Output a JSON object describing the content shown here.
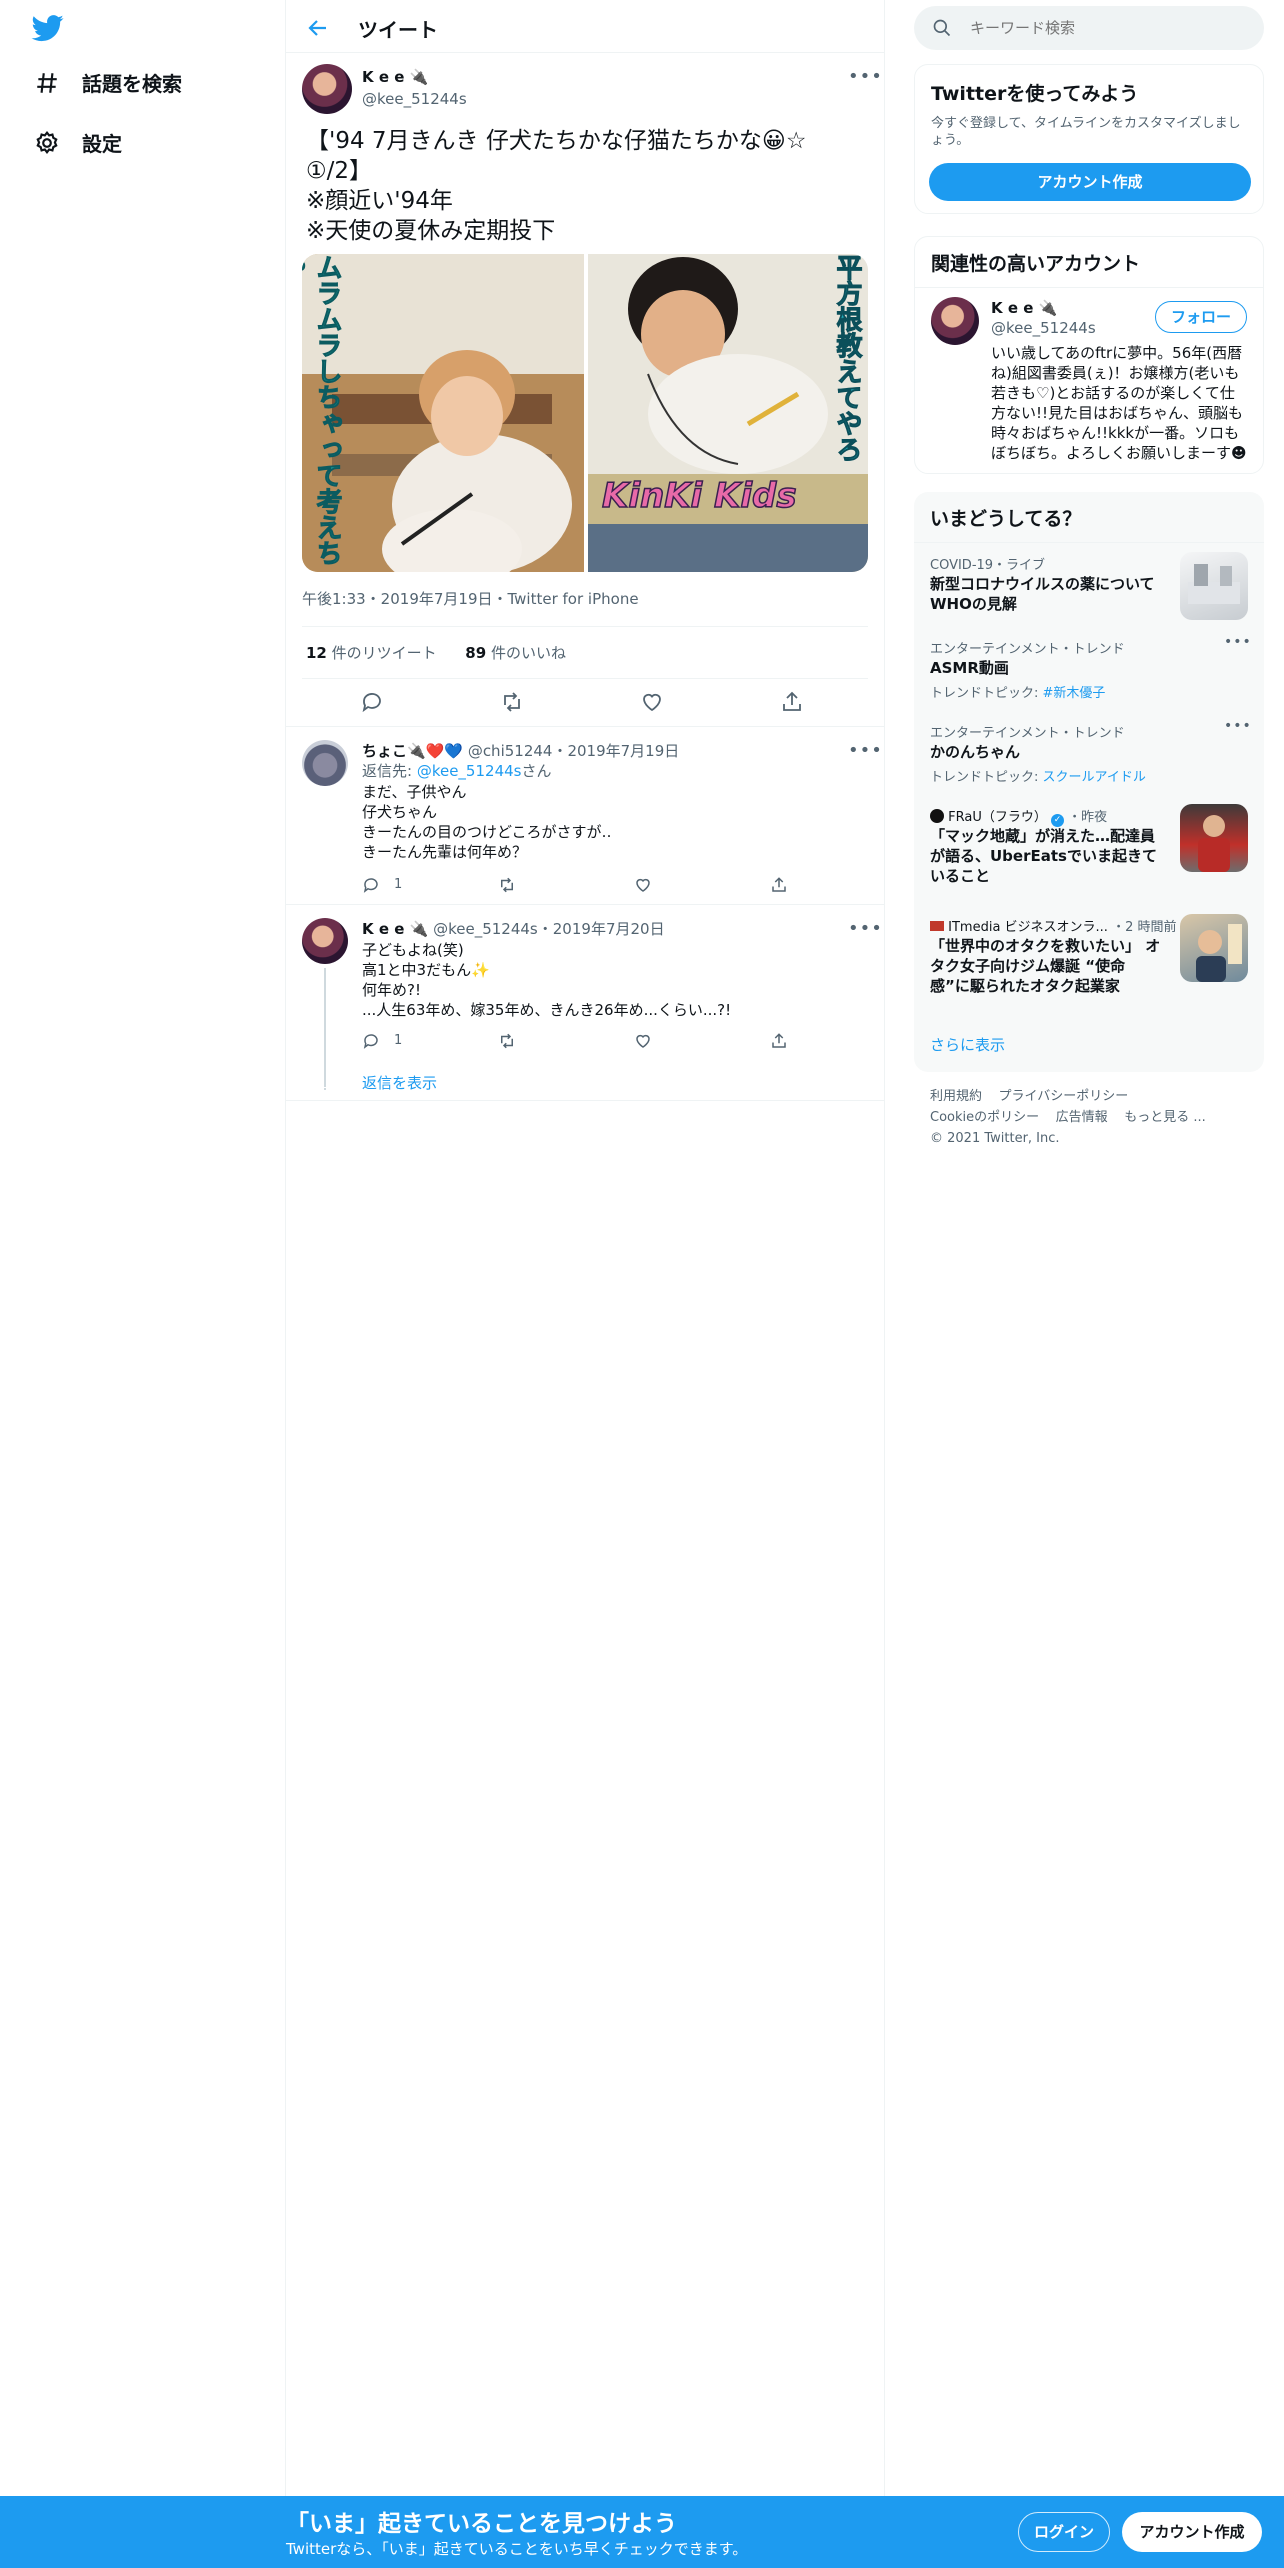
{
  "nav": {
    "search_label": "話題を検索",
    "settings_label": "設定"
  },
  "header": {
    "title": "ツイート"
  },
  "tweet": {
    "name": "K e e 🔌",
    "handle": "@kee_51244s",
    "lines": [
      "【'94 7月きんき 仔犬たちかな仔猫たちかな😀☆",
      "①/2】",
      "※顔近い'94年",
      "※天使の夏休み定期投下"
    ],
    "photo_left_text": "ムラムラしちゃって考えちゃう",
    "photo_right_text": "平方根教えてやろ",
    "photo_right_logo": "KinKi Kids",
    "meta": "午後1:33・2019年7月19日・Twitter for iPhone",
    "retweets": "12",
    "retweets_label": "件のリツイート",
    "likes": "89",
    "likes_label": "件のいいね"
  },
  "replies": [
    {
      "name": "ちょこ🔌❤️💙",
      "handle": "@chi51244",
      "date": "・2019年7月19日",
      "reply_to_label": "返信先: ",
      "reply_to": "@kee_51244s",
      "reply_to_suffix": "さん",
      "lines": [
        "まだ、子供やん",
        "仔犬ちゃん",
        "きーたんの目のつけどころがさすが‥",
        "きーたん先輩は何年め？"
      ],
      "reply_count": "1"
    },
    {
      "name": "K e e 🔌",
      "handle": "@kee_51244s",
      "date": "・2019年7月20日",
      "lines": [
        "子どもよね(笑)",
        "高1と中3だもん✨",
        "何年め?!",
        "...人生63年め、嫁35年め、きんき26年め...くらい...?!"
      ],
      "reply_count": "1"
    }
  ],
  "show_replies": "返信を表示",
  "search": {
    "placeholder": "キーワード検索"
  },
  "signup": {
    "title": "Twitterを使ってみよう",
    "desc": "今すぐ登録して、タイムラインをカスタマイズしましょう。",
    "button": "アカウント作成"
  },
  "related": {
    "title": "関連性の高いアカウント",
    "name": "K e e 🔌",
    "handle": "@kee_51244s",
    "follow": "フォロー",
    "bio_lines": [
      "いい歳してあのftrに夢中。56年(西暦",
      "ね)組図書委員(ぇ)！お嬢様方(老いも",
      "若きも♡)とお話するのが楽しくて仕",
      "方ない!!見た目はおばちゃん、頭脳も",
      "時々おばちゃん!!kkkが一番。ソロも",
      "ぼちぼち。よろしくお願いしまーす☻"
    ]
  },
  "trends": {
    "title": "いまどうしてる？",
    "items": [
      {
        "cat": "COVID-19・ライブ",
        "title": "新型コロナウイルスの薬について WHOの見解"
      },
      {
        "cat": "エンターテインメント・トレンド",
        "title": "ASMR動画",
        "sub_label": "トレンドトピック: ",
        "sub_link": "#新木優子"
      },
      {
        "cat": "エンターテインメント・トレンド",
        "title": "かのんちゃん",
        "sub_label": "トレンドトピック: ",
        "sub_link": "スクールアイドル"
      },
      {
        "source": "FRaU（フラウ）",
        "time": "・昨夜",
        "title": "「マック地蔵」が消えた…配達員が語る、UberEatsでいま起きていること"
      },
      {
        "source": "ITmedia ビジネスオンラ...",
        "time": "・2 時間前",
        "title": "「世界中のオタクを救いたい」 オタク女子向けジム爆誕 “使命感”に駆られたオタク起業家"
      }
    ],
    "show_more": "さらに表示"
  },
  "footer": {
    "links_row1": [
      "利用規約",
      "プライバシーポリシー"
    ],
    "links_row2": [
      "Cookieのポリシー",
      "広告情報",
      "もっと見る ..."
    ],
    "copyright": "© 2021 Twitter, Inc."
  },
  "bottom": {
    "headline": "「いま」起きていることを見つけよう",
    "sub": "Twitterなら、「いま」起きていることをいち早くチェックできます。",
    "login": "ログイン",
    "signup": "アカウント作成"
  },
  "colors": {
    "accent": "#1d9bf0",
    "text": "#0f1419",
    "muted": "#536471",
    "border": "#eff3f4"
  }
}
